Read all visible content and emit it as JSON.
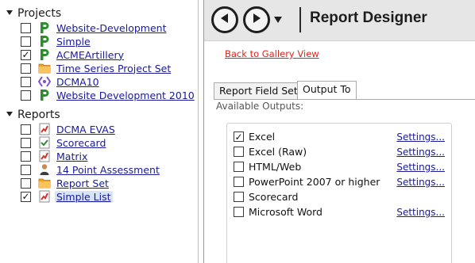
{
  "tree": {
    "projects_header": "Projects",
    "projects": [
      {
        "label": "Website-Development",
        "checked": false,
        "icon": "project-p-icon"
      },
      {
        "label": "Simple",
        "checked": false,
        "icon": "project-p-icon"
      },
      {
        "label": "ACMEArtillery",
        "checked": true,
        "icon": "project-p-icon"
      },
      {
        "label": "Time Series Project Set",
        "checked": false,
        "icon": "folder-icon"
      },
      {
        "label": "DCMA10",
        "checked": false,
        "icon": "brackets-icon"
      },
      {
        "label": "Website Development 2010",
        "checked": false,
        "icon": "project-p-icon"
      }
    ],
    "reports_header": "Reports",
    "reports": [
      {
        "label": "DCMA EVAS",
        "checked": false,
        "icon": "chart-report-icon"
      },
      {
        "label": "Scorecard",
        "checked": false,
        "icon": "scorecard-icon"
      },
      {
        "label": "Matrix",
        "checked": false,
        "icon": "chart-report-icon"
      },
      {
        "label": "14 Point Assessment",
        "checked": false,
        "icon": "person-icon"
      },
      {
        "label": "Report Set",
        "checked": false,
        "icon": "folder-icon"
      },
      {
        "label": "Simple List",
        "checked": true,
        "icon": "chart-report-icon",
        "selected": true
      }
    ],
    "check_mark": "✓"
  },
  "toolbar": {
    "title": "Report Designer",
    "back_icon": "back-arrow-icon",
    "forward_icon": "forward-arrow-icon",
    "dropdown_icon": "dropdown-arrow-icon"
  },
  "content": {
    "gallery_link": "Back to Gallery View",
    "tabs": [
      {
        "label": "Report Field Setup",
        "active": false
      },
      {
        "label": "Output To",
        "active": true
      }
    ],
    "available_label": "Available Outputs:",
    "outputs": [
      {
        "label": "Excel",
        "checked": true,
        "settings": "Settings..."
      },
      {
        "label": "Excel (Raw)",
        "checked": false,
        "settings": "Settings..."
      },
      {
        "label": "HTML/Web",
        "checked": false,
        "settings": "Settings..."
      },
      {
        "label": "PowerPoint 2007 or higher",
        "checked": false,
        "settings": "Settings..."
      },
      {
        "label": "Scorecard",
        "checked": false,
        "settings": ""
      },
      {
        "label": "Microsoft Word",
        "checked": false,
        "settings": "Settings..."
      }
    ]
  },
  "colors": {
    "project_icon_green": "#2e8b2e",
    "folder_orange": "#f0a020",
    "link_blue": "#1a1a9a",
    "gallery_link_red": "#e0231a",
    "toolbar_bg": "#e6e6e6",
    "selection_bg": "#d7e4f2"
  }
}
